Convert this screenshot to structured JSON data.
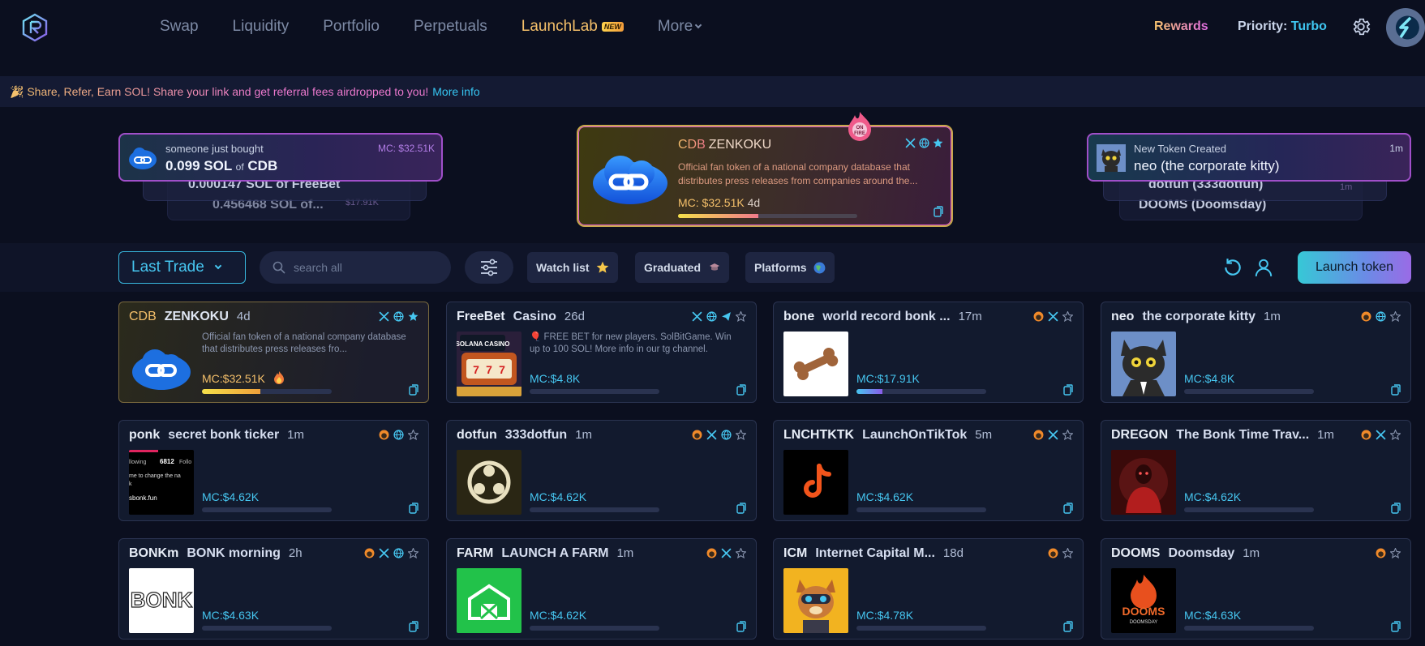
{
  "nav": {
    "items": [
      {
        "label": "Swap"
      },
      {
        "label": "Liquidity"
      },
      {
        "label": "Portfolio"
      },
      {
        "label": "Perpetuals"
      },
      {
        "label": "LaunchLab",
        "badge": "NEW"
      },
      {
        "label": "More"
      }
    ],
    "rewards": "Rewards",
    "priority_label": "Priority:",
    "priority_value": "Turbo"
  },
  "banner": {
    "text": "🎉 Share, Refer, Earn SOL! Share your link and get referral fees airdropped to you!",
    "link": "More info"
  },
  "ticker_left": {
    "sub": "someone just bought",
    "amount": "0.099 SOL",
    "of": "of",
    "token": "CDB",
    "mc": "MC: $32.51K",
    "ghost1": "0.000147 SOL of FreeBet",
    "ghost2": "0.456468 SOL of...",
    "ghost2_mc": "$17.91K"
  },
  "ticker_right": {
    "sub": "New Token Created",
    "token": "neo (the corporate kitty)",
    "time": "1m",
    "ghost1": "dotfun (333dotfun)",
    "ghost1_time": "1m",
    "ghost2": "DOOMS (Doomsday)"
  },
  "featured": {
    "symbol": "CDB",
    "name": "ZENKOKU",
    "description": "Official fan token of a national company database that distributes press releases from companies around the...",
    "mc": "MC: $32.51K",
    "age": "4d",
    "progress": 0.45,
    "badge": "ON FIRE"
  },
  "filters": {
    "sort": "Last Trade",
    "search_placeholder": "search all",
    "watchlist": "Watch list",
    "graduated": "Graduated",
    "platforms": "Platforms",
    "launch": "Launch token"
  },
  "tokens": [
    {
      "symbol": "CDB",
      "name": "ZENKOKU",
      "age": "4d",
      "desc": "Official fan token of a national company database that distributes press releases fro...",
      "mc": "MC:$32.51K",
      "progress": 0.45,
      "hot": true
    },
    {
      "symbol": "FreeBet",
      "name": "Casino",
      "age": "26d",
      "desc": "🎈 FREE BET for new players. SolBitGame. Win up to 100 SOL! More info in our tg channel.",
      "mc": "MC:$4.8K",
      "progress": 0.0
    },
    {
      "symbol": "bone",
      "name": "world record bonk ...",
      "age": "17m",
      "desc": "",
      "mc": "MC:$17.91K",
      "progress": 0.2
    },
    {
      "symbol": "neo",
      "name": "the corporate kitty",
      "age": "1m",
      "desc": "",
      "mc": "MC:$4.8K",
      "progress": 0.0
    },
    {
      "symbol": "ponk",
      "name": "secret bonk ticker",
      "age": "1m",
      "desc": "",
      "mc": "MC:$4.62K",
      "progress": 0.0
    },
    {
      "symbol": "dotfun",
      "name": "333dotfun",
      "age": "1m",
      "desc": "",
      "mc": "MC:$4.62K",
      "progress": 0.0
    },
    {
      "symbol": "LNCHTKTK",
      "name": "LaunchOnTikTok",
      "age": "5m",
      "desc": "",
      "mc": "MC:$4.62K",
      "progress": 0.0
    },
    {
      "symbol": "DREGON",
      "name": "The Bonk Time Trav...",
      "age": "1m",
      "desc": "",
      "mc": "MC:$4.62K",
      "progress": 0.0
    },
    {
      "symbol": "BONKm",
      "name": "BONK morning",
      "age": "2h",
      "desc": "",
      "mc": "MC:$4.63K",
      "progress": 0.0
    },
    {
      "symbol": "FARM",
      "name": "LAUNCH A FARM",
      "age": "1m",
      "desc": "",
      "mc": "MC:$4.62K",
      "progress": 0.0
    },
    {
      "symbol": "ICM",
      "name": "Internet Capital M...",
      "age": "18d",
      "desc": "",
      "mc": "MC:$4.78K",
      "progress": 0.0
    },
    {
      "symbol": "DOOMS",
      "name": "Doomsday",
      "age": "1m",
      "desc": "",
      "mc": "MC:$4.63K",
      "progress": 0.0
    }
  ],
  "image_text": {
    "casino": "SOLANA CASINO",
    "ponk_followers": "6812",
    "ponk_line1": "llowing",
    "ponk_line2": "Follo",
    "ponk_line3": "me to change the na",
    "ponk_line4": "k",
    "ponk_line5": "sbonk.fun",
    "bonk": "BONK",
    "dooms": "DOOMS",
    "dooms_sub": "DOOMSDAY"
  },
  "colors": {
    "accent": "#46c6f0",
    "gold": "#f5c06a",
    "bg": "#0b0f1f",
    "card": "#121a2e"
  }
}
